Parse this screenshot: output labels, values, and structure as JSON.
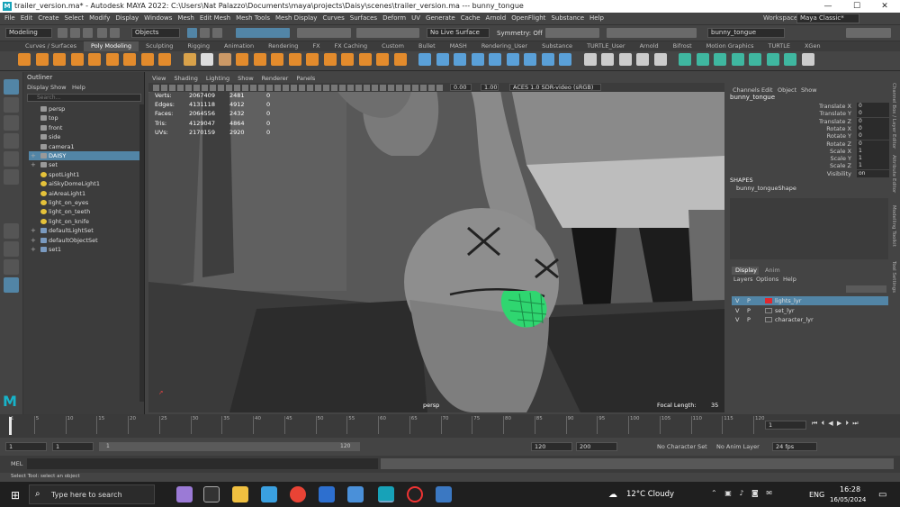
{
  "window": {
    "title": "trailer_version.ma* - Autodesk MAYA 2022: C:\\Users\\Nat Palazzo\\Documents\\maya\\projects\\Daisy\\scenes\\trailer_version.ma  ---  bunny_tongue",
    "minimize": "—",
    "maximize": "☐",
    "close": "✕"
  },
  "menus": [
    "File",
    "Edit",
    "Create",
    "Select",
    "Modify",
    "Display",
    "Windows",
    "Mesh",
    "Edit Mesh",
    "Mesh Tools",
    "Mesh Display",
    "Curves",
    "Surfaces",
    "Deform",
    "UV",
    "Generate",
    "Cache",
    "Arnold",
    "OpenFlight",
    "Substance",
    "Help"
  ],
  "workspace": {
    "label": "Workspace :",
    "value": "Maya Classic*"
  },
  "status": {
    "mode": "Modeling",
    "objects": "Objects",
    "live_surface": "No Live Surface",
    "symmetry": "Symmetry: Off",
    "name_field": "bunny_tongue"
  },
  "shelf_tabs": [
    "Curves / Surfaces",
    "Poly Modeling",
    "Sculpting",
    "Rigging",
    "Animation",
    "Rendering",
    "FX",
    "FX Caching",
    "Custom",
    "Bullet",
    "MASH",
    "Rendering_User",
    "Substance",
    "TURTLE_User",
    "Arnold",
    "Bifrost",
    "Motion Graphics",
    "TURTLE",
    "XGen"
  ],
  "outliner": {
    "title": "Outliner",
    "menu": [
      "Display",
      "Show",
      "Help"
    ],
    "search_placeholder": "Search...",
    "items": [
      {
        "label": "persp",
        "type": "cam",
        "expand": ""
      },
      {
        "label": "top",
        "type": "cam",
        "expand": ""
      },
      {
        "label": "front",
        "type": "cam",
        "expand": ""
      },
      {
        "label": "side",
        "type": "cam",
        "expand": ""
      },
      {
        "label": "camera1",
        "type": "cam",
        "expand": ""
      },
      {
        "label": "DAISY",
        "type": "grp",
        "expand": "+"
      },
      {
        "label": "set",
        "type": "grp",
        "expand": "+"
      },
      {
        "label": "spotLight1",
        "type": "light",
        "expand": ""
      },
      {
        "label": "aiSkyDomeLight1",
        "type": "light",
        "expand": ""
      },
      {
        "label": "aiAreaLight1",
        "type": "light",
        "expand": ""
      },
      {
        "label": "light_on_eyes",
        "type": "light",
        "expand": ""
      },
      {
        "label": "light_on_teeth",
        "type": "light",
        "expand": ""
      },
      {
        "label": "light_on_knife",
        "type": "light",
        "expand": ""
      },
      {
        "label": "defaultLightSet",
        "type": "set",
        "expand": "+"
      },
      {
        "label": "defaultObjectSet",
        "type": "set",
        "expand": "+"
      },
      {
        "label": "set1",
        "type": "set",
        "expand": "+"
      }
    ]
  },
  "viewport": {
    "menu": [
      "View",
      "Shading",
      "Lighting",
      "Show",
      "Renderer",
      "Panels"
    ],
    "exposure": "0.00",
    "gamma": "1.00",
    "colorspace": "ACES 1.0 SDR-video (sRGB)",
    "camera": "persp",
    "focal_label": "Focal Length:",
    "focal_value": "35",
    "stats": [
      {
        "label": "Verts:",
        "a": "2067409",
        "b": "2481",
        "c": "0"
      },
      {
        "label": "Edges:",
        "a": "4131118",
        "b": "4912",
        "c": "0"
      },
      {
        "label": "Faces:",
        "a": "2064556",
        "b": "2432",
        "c": "0"
      },
      {
        "label": "Tris:",
        "a": "4129047",
        "b": "4864",
        "c": "0"
      },
      {
        "label": "UVs:",
        "a": "2170159",
        "b": "2920",
        "c": "0"
      }
    ]
  },
  "channel_box": {
    "menu": [
      "Channels",
      "Edit",
      "Object",
      "Show"
    ],
    "object": "bunny_tongue",
    "attrs": [
      {
        "name": "Translate X",
        "value": "0"
      },
      {
        "name": "Translate Y",
        "value": "0"
      },
      {
        "name": "Translate Z",
        "value": "0"
      },
      {
        "name": "Rotate X",
        "value": "0"
      },
      {
        "name": "Rotate Y",
        "value": "0"
      },
      {
        "name": "Rotate Z",
        "value": "0"
      },
      {
        "name": "Scale X",
        "value": "1"
      },
      {
        "name": "Scale Y",
        "value": "1"
      },
      {
        "name": "Scale Z",
        "value": "1"
      },
      {
        "name": "Visibility",
        "value": "on"
      }
    ],
    "shapes_label": "SHAPES",
    "shape_name": "bunny_tongueShape",
    "side_tabs": [
      "Channel Box / Layer Editor",
      "Attribute Editor",
      "Modelling Toolkit",
      "Tool Settings"
    ]
  },
  "layer_editor": {
    "tabs": [
      "Display",
      "Anim"
    ],
    "menu": [
      "Layers",
      "Options",
      "Help"
    ],
    "layers": [
      {
        "v": "V",
        "p": "P",
        "name": "lights_lyr",
        "color": "#e0282e"
      },
      {
        "v": "V",
        "p": "P",
        "name": "set_lyr",
        "color": ""
      },
      {
        "v": "V",
        "p": "P",
        "name": "character_lyr",
        "color": ""
      }
    ]
  },
  "timeline": {
    "ticks": [
      "1",
      "5",
      "10",
      "15",
      "20",
      "25",
      "30",
      "35",
      "40",
      "45",
      "50",
      "55",
      "60",
      "65",
      "70",
      "75",
      "80",
      "85",
      "90",
      "95",
      "100",
      "105",
      "110",
      "115",
      "120"
    ],
    "current": "1"
  },
  "range": {
    "start": "1",
    "start2": "1",
    "slider_start": "1",
    "slider_end": "120",
    "end": "120",
    "end2": "200",
    "char_set": "No Character Set",
    "anim_layer": "No Anim Layer",
    "fps": "24 fps"
  },
  "mel": {
    "label": "MEL"
  },
  "help_line": "Select Tool: select an object",
  "taskbar": {
    "search": "Type here to search",
    "weather": "12°C  Cloudy",
    "lang": "ENG",
    "time": "16:28",
    "date": "16/05/2024"
  }
}
